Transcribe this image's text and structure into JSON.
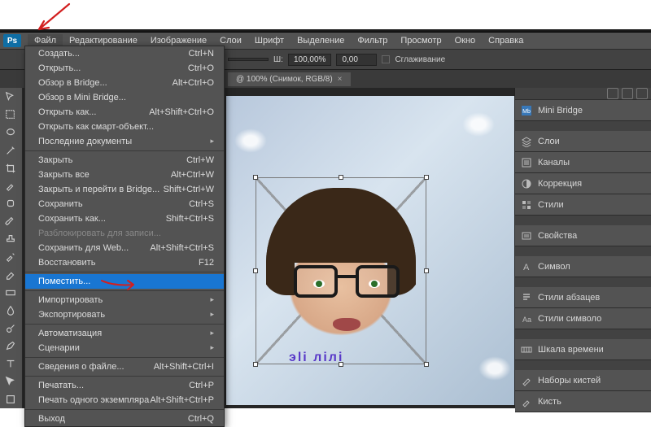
{
  "logo": "Ps",
  "menubar": [
    "Файл",
    "Редактирование",
    "Изображение",
    "Слои",
    "Шрифт",
    "Выделение",
    "Фильтр",
    "Просмотр",
    "Окно",
    "Справка"
  ],
  "options": {
    "w_label": "Ш:",
    "w_value": "100,00%",
    "h_value": "0,00",
    "smoothing": "Сглаживание",
    "field1": ""
  },
  "tab": {
    "title": "@ 100% (Снимок, RGB/8)",
    "close": "×"
  },
  "menu": {
    "items": [
      {
        "label": "Создать...",
        "shortcut": "Ctrl+N"
      },
      {
        "label": "Открыть...",
        "shortcut": "Ctrl+O"
      },
      {
        "label": "Обзор в Bridge...",
        "shortcut": "Alt+Ctrl+O"
      },
      {
        "label": "Обзор в Mini Bridge...",
        "shortcut": ""
      },
      {
        "label": "Открыть как...",
        "shortcut": "Alt+Shift+Ctrl+O"
      },
      {
        "label": "Открыть как смарт-объект...",
        "shortcut": ""
      },
      {
        "label": "Последние документы",
        "shortcut": "",
        "sub": true
      },
      {
        "sep": true
      },
      {
        "label": "Закрыть",
        "shortcut": "Ctrl+W"
      },
      {
        "label": "Закрыть все",
        "shortcut": "Alt+Ctrl+W"
      },
      {
        "label": "Закрыть и перейти в Bridge...",
        "shortcut": "Shift+Ctrl+W"
      },
      {
        "label": "Сохранить",
        "shortcut": "Ctrl+S"
      },
      {
        "label": "Сохранить как...",
        "shortcut": "Shift+Ctrl+S"
      },
      {
        "label": "Разблокировать для записи...",
        "shortcut": "",
        "disabled": true
      },
      {
        "label": "Сохранить для Web...",
        "shortcut": "Alt+Shift+Ctrl+S"
      },
      {
        "label": "Восстановить",
        "shortcut": "F12"
      },
      {
        "sep": true
      },
      {
        "label": "Поместить...",
        "shortcut": "",
        "selected": true
      },
      {
        "sep": true
      },
      {
        "label": "Импортировать",
        "shortcut": "",
        "sub": true
      },
      {
        "label": "Экспортировать",
        "shortcut": "",
        "sub": true
      },
      {
        "sep": true
      },
      {
        "label": "Автоматизация",
        "shortcut": "",
        "sub": true
      },
      {
        "label": "Сценарии",
        "shortcut": "",
        "sub": true
      },
      {
        "sep": true
      },
      {
        "label": "Сведения о файле...",
        "shortcut": "Alt+Shift+Ctrl+I"
      },
      {
        "sep": true
      },
      {
        "label": "Печатать...",
        "shortcut": "Ctrl+P"
      },
      {
        "label": "Печать одного экземпляра",
        "shortcut": "Alt+Shift+Ctrl+P"
      },
      {
        "sep": true
      },
      {
        "label": "Выход",
        "shortcut": "Ctrl+Q"
      }
    ]
  },
  "panels": {
    "group1": [
      {
        "icon": "mb",
        "label": "Mini Bridge",
        "color": "#3878b8"
      }
    ],
    "group2": [
      {
        "icon": "layers",
        "label": "Слои"
      },
      {
        "icon": "channels",
        "label": "Каналы"
      },
      {
        "icon": "adjust",
        "label": "Коррекция"
      },
      {
        "icon": "styles",
        "label": "Стили"
      }
    ],
    "group3": [
      {
        "icon": "props",
        "label": "Свойства"
      }
    ],
    "group4": [
      {
        "icon": "char",
        "label": "Символ"
      }
    ],
    "group5": [
      {
        "icon": "para",
        "label": "Стили абзацев"
      },
      {
        "icon": "cstr",
        "label": "Стили символо"
      }
    ],
    "group6": [
      {
        "icon": "time",
        "label": "Шкала времени"
      }
    ],
    "group7": [
      {
        "icon": "brush",
        "label": "Наборы кистей"
      },
      {
        "icon": "brush2",
        "label": "Кисть"
      }
    ]
  },
  "watermark": "эli лiлi",
  "arrow_color": "#d21f1f"
}
